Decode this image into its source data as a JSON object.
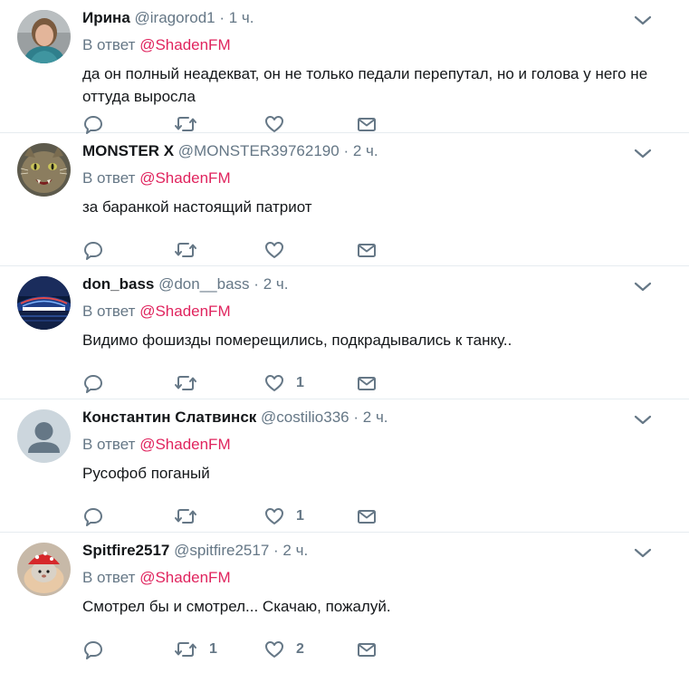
{
  "reply_prefix": "В ответ",
  "tweets": [
    {
      "fullname": "Ирина",
      "handle": "@iragorod1",
      "dot": "·",
      "time": "1 ч.",
      "reply_mention": "@ShadenFM",
      "text": "да он полный неадекват, он не только педали перепутал, но и голова у него не оттуда выросла",
      "retweets": "",
      "likes": ""
    },
    {
      "fullname": "MONSTER X",
      "handle": "@MONSTER39762190",
      "dot": "·",
      "time": "2 ч.",
      "reply_mention": "@ShadenFM",
      "text": "за баранкой настоящий патриот",
      "retweets": "",
      "likes": ""
    },
    {
      "fullname": "don_bass",
      "handle": "@don__bass",
      "dot": "·",
      "time": "2 ч.",
      "reply_mention": "@ShadenFM",
      "text": "Видимо фошизды померещились, подкрадывались к танку..",
      "retweets": "",
      "likes": "1"
    },
    {
      "fullname": "Константин Слатвинск",
      "handle": "@costilio336",
      "dot": "·",
      "time": "2 ч.",
      "reply_mention": "@ShadenFM",
      "text": "Русофоб поганый",
      "retweets": "",
      "likes": "1"
    },
    {
      "fullname": "Spitfire2517",
      "handle": "@spitfire2517",
      "dot": "·",
      "time": "2 ч.",
      "reply_mention": "@ShadenFM",
      "text": "Смотрел бы и смотрел... Скачаю, пожалуй.",
      "retweets": "1",
      "likes": "2"
    }
  ],
  "colors": {
    "mention": "#e0245e",
    "secondary_text": "#657786",
    "divider": "#e6ecf0"
  },
  "icons": [
    "chevron-down-icon",
    "reply-icon",
    "retweet-icon",
    "heart-icon",
    "envelope-icon"
  ]
}
